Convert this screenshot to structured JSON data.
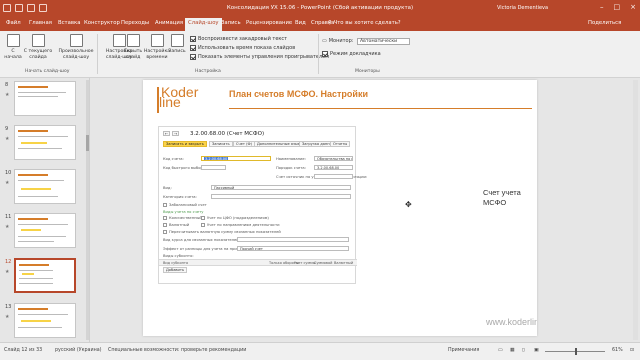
{
  "window": {
    "title": "Консолидация УХ 15.06 - PowerPoint (Сбой активации продукта)",
    "user": "Victoria Dementieva"
  },
  "tabs": [
    "Файл",
    "Главная",
    "Вставка",
    "Конструктор",
    "Переходы",
    "Анимация",
    "Слайд-шоу",
    "Запись",
    "Рецензирование",
    "Вид",
    "Справка"
  ],
  "tell_me": "Что вы хотите сделать?",
  "share": "Поделиться",
  "ribbon": {
    "buttons": [
      {
        "label": "С начала"
      },
      {
        "label": "С текущего слайда"
      },
      {
        "label": "Произвольное слайд-шоу"
      },
      {
        "label": "Настройка слайд-шоу"
      },
      {
        "label": "Скрыть слайд"
      },
      {
        "label": "Настройка времени"
      },
      {
        "label": "Запись"
      }
    ],
    "checks": [
      "Воспроизвести закадровый текст",
      "Использовать время показа слайдов",
      "Показать элементы управления проигрывателем"
    ],
    "monitor_label": "Монитор:",
    "monitor_value": "Автоматически",
    "presenter_label": "Режим докладчика",
    "groups": [
      "Начать слайд-шоу",
      "Настройка",
      "Мониторы"
    ]
  },
  "thumbs": [
    {
      "num": "8"
    },
    {
      "num": "9"
    },
    {
      "num": "10"
    },
    {
      "num": "11"
    },
    {
      "num": "12"
    },
    {
      "num": "13"
    }
  ],
  "slide": {
    "logo_top": "Koder",
    "logo_bottom": "line",
    "title": "План счетов МСФО. Настройки",
    "side_text_1": "Счет учета",
    "side_text_2": "МСФО",
    "url": "www.koderline.ru",
    "form": {
      "title": "3.2.00.68.00 (Счет МСФО)",
      "toolbar": [
        "Записать и закрыть",
        "Записать",
        "Счет (Ф)",
        "Дополнительные языки",
        "Загрузка данных",
        "Отчеты"
      ],
      "labels": {
        "code": "Код счета:",
        "quick": "Код быстрого выбора:",
        "name": "Наименование:",
        "order": "Порядок счета:",
        "source": "Счет источник по умолчанию для трансляции:",
        "kind": "Вид:",
        "category": "Категория счета:",
        "offbalance": "Забалансовый счет",
        "sections": "Виды учета по счету",
        "qty": "Количественный",
        "currency": "Валютный",
        "cfo": "Учет по ЦФО (подразделениям)",
        "direction": "Учет по направлениям деятельности",
        "revaluation": "Пересчитывать валютную сумму связанных показателей",
        "course": "Вид курса для связанных показателей:",
        "effect": "Эффект от разницы для учета на прибыль:",
        "subconto": "Виды субконто:",
        "add": "Добавить"
      },
      "values": {
        "code": "3.2.00.68.00",
        "name": "Обязательства по налогам",
        "order": "3.2.00.68.00",
        "kind": "Пассивный",
        "effect": "Прочий счет"
      },
      "grid_cols": [
        "Вид субконто",
        "Только обороты",
        "Учет суммы",
        "Суммовой",
        "Валютный"
      ]
    }
  },
  "status": {
    "slide": "Слайд 12 из 33",
    "lang": "русский (Украина)",
    "access": "Специальные возможности: проверьте рекомендации",
    "notes": "Примечания",
    "zoom": "61%"
  }
}
